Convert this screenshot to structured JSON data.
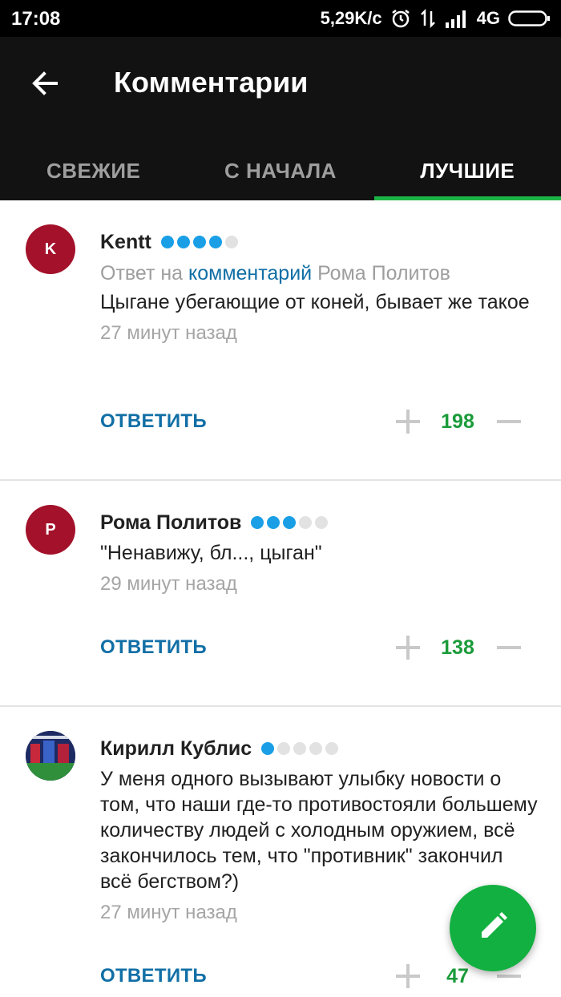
{
  "status_bar": {
    "time": "17:08",
    "speed": "5,29K/c",
    "network": "4G"
  },
  "app_bar": {
    "back_icon": "arrow-back-icon",
    "title": "Комментарии"
  },
  "tabs": [
    {
      "label": "СВЕЖИЕ",
      "active": false
    },
    {
      "label": "С НАЧАЛА",
      "active": false
    },
    {
      "label": "ЛУЧШИЕ",
      "active": true
    }
  ],
  "comments": [
    {
      "avatar_letter": "K",
      "author": "Kentt",
      "rating": 4,
      "rating_max": 5,
      "reply_prefix": "Ответ на",
      "reply_link": "комментарий",
      "reply_author": "Рома Политов",
      "text": "Цыгане убегающие от коней, бывает же такое",
      "time": "27 минут назад",
      "answer_label": "ОТВЕТИТЬ",
      "score": "198"
    },
    {
      "avatar_letter": "P",
      "author": "Рома Политов",
      "rating": 3,
      "rating_max": 5,
      "text": "\"Ненавижу, бл..., цыган\"",
      "time": "29 минут назад",
      "answer_label": "ОТВЕТИТЬ",
      "score": "138"
    },
    {
      "avatar_letter": "",
      "author": "Кирилл Кублис",
      "rating": 1,
      "rating_max": 5,
      "text": "У меня одного вызывают улыбку новости о том, что наши где-то противостояли большему количеству людей с холодным оружием, всё закончилось тем, что \"противник\" закончил всё бегством?)",
      "time": "27 минут назад",
      "answer_label": "ОТВЕТИТЬ",
      "score": "47"
    }
  ],
  "fab": {
    "icon": "pencil-icon"
  },
  "colors": {
    "accent_green": "#1db446",
    "link_blue": "#116fa6",
    "rating_blue": "#1a9fe6",
    "score_green": "#1a9b3a",
    "avatar_red": "#a3112a"
  }
}
